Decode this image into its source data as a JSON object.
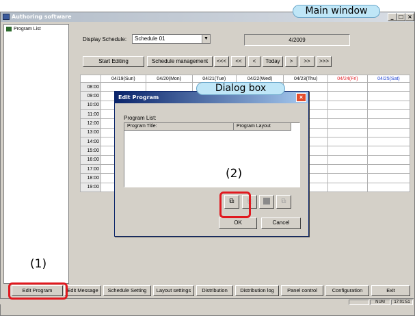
{
  "window": {
    "title": "Authoring software",
    "callout": "Main window"
  },
  "tree": {
    "root_label": "Program List"
  },
  "schedule": {
    "display_label": "Display Schedule:",
    "selected": "Schedule 01",
    "date": "4/2009",
    "buttons": [
      "Start Editing",
      "Schedule management",
      "<<<",
      "<<",
      "<",
      "Today",
      ">",
      ">>",
      ">>>"
    ]
  },
  "grid": {
    "days": [
      {
        "label": "04/19(Sun)",
        "color": "#000000"
      },
      {
        "label": "04/20(Mon)",
        "color": "#000000"
      },
      {
        "label": "04/21(Tue)",
        "color": "#000000"
      },
      {
        "label": "04/22(Wed)",
        "color": "#000000"
      },
      {
        "label": "04/23(Thu)",
        "color": "#000000"
      },
      {
        "label": "04/24(Fri)",
        "color": "#e0191f"
      },
      {
        "label": "04/25(Sat)",
        "color": "#1a3fd0"
      }
    ],
    "times": [
      "08:00",
      "09:00",
      "10:00",
      "11:00",
      "12:00",
      "13:00",
      "14:00",
      "15:00",
      "16:00",
      "17:00",
      "18:00",
      "19:00"
    ]
  },
  "dialog": {
    "title": "Edit Program",
    "callout": "Dialog box",
    "list_label": "Program List:",
    "col_title": "Program Title:",
    "col_layout": "Program Layout",
    "ok": "OK",
    "cancel": "Cancel"
  },
  "marks": {
    "one": "(1)",
    "two": "(2)"
  },
  "toolbar": {
    "buttons": [
      "Edit Program",
      "Edit Message",
      "Schedule Setting",
      "Layout settings",
      "Distribution",
      "Distribution log",
      "Panel control",
      "Configuration",
      "Exit"
    ]
  },
  "status": {
    "num": "NUM",
    "time": "17:01:51"
  },
  "colors": {
    "highlight": "#e0191f",
    "callout_bg": "#bfe6f7",
    "dialog_title": "#0a246a"
  },
  "icons": [
    "app-icon",
    "tree-icon",
    "minimize-icon",
    "maximize-icon",
    "close-icon",
    "add-program-icon",
    "copy-icon",
    "delete-icon",
    "duplicate-icon"
  ]
}
